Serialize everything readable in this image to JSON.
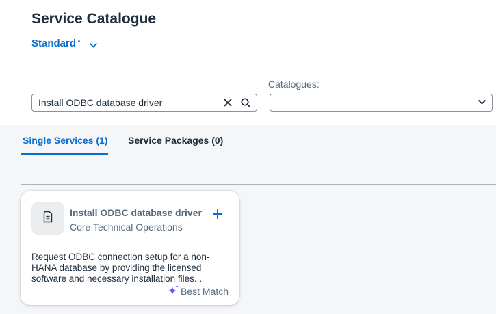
{
  "header": {
    "title": "Service Catalogue",
    "variant": {
      "label": "Standard",
      "modified_marker": "*"
    }
  },
  "filters": {
    "search": {
      "value": "Install ODBC database driver"
    },
    "catalogues": {
      "label": "Catalogues:",
      "selected": ""
    }
  },
  "tabs": [
    {
      "label": "Single Services (1)",
      "selected": true
    },
    {
      "label": "Service Packages (0)",
      "selected": false
    }
  ],
  "results": [
    {
      "title": "Install ODBC database driver",
      "subtitle": "Core Technical Operations",
      "description": "Request ODBC connection setup for a non-HANA database by providing the licensed software and necessary installation files...",
      "match_label": "Best Match",
      "icon": "document-icon"
    }
  ],
  "colors": {
    "accent": "#0a6ed1",
    "text": "#1d2d3e",
    "secondary_text": "#556b82",
    "ai_sparkle": "#7a4de0"
  }
}
